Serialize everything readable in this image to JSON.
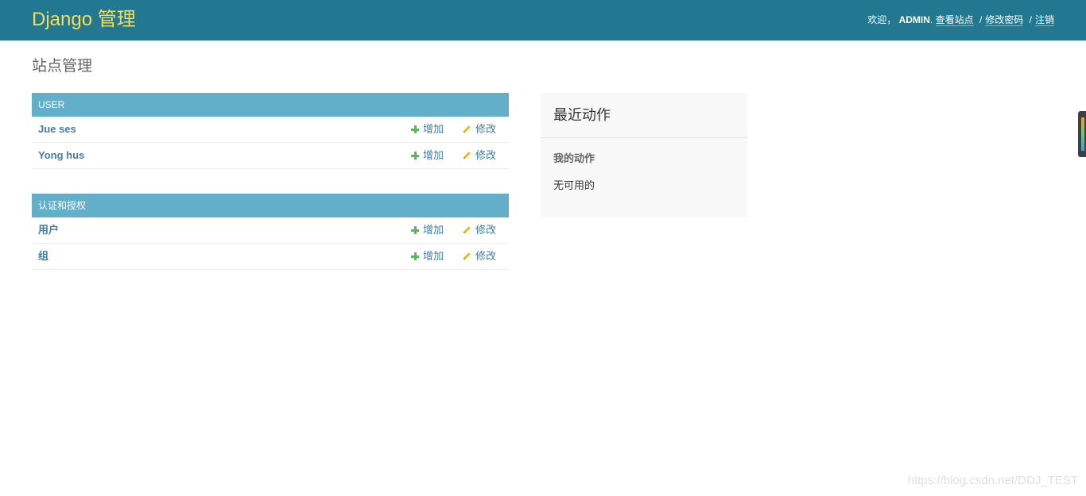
{
  "header": {
    "brand": "Django 管理",
    "welcome": "欢迎，",
    "username": "ADMIN",
    "after_username": ".",
    "view_site": "查看站点",
    "sep": "/",
    "change_password": "修改密码",
    "logout": "注销",
    "colors": {
      "bar": "#227890",
      "brand": "#f5dd5d"
    }
  },
  "page_title": "站点管理",
  "modules": [
    {
      "caption": "USER",
      "models": [
        {
          "name": "Jue ses",
          "add": "增加",
          "change": "修改"
        },
        {
          "name": "Yong hus",
          "add": "增加",
          "change": "修改"
        }
      ]
    },
    {
      "caption": "认证和授权",
      "models": [
        {
          "name": "用户",
          "add": "增加",
          "change": "修改"
        },
        {
          "name": "组",
          "add": "增加",
          "change": "修改"
        }
      ]
    }
  ],
  "recent_actions": {
    "title": "最近动作",
    "subtitle": "我的动作",
    "empty": "无可用的"
  },
  "watermark": "https://blog.csdn.net/DDJ_TEST",
  "icons": {
    "add": "plus-icon",
    "change": "pencil-icon"
  }
}
